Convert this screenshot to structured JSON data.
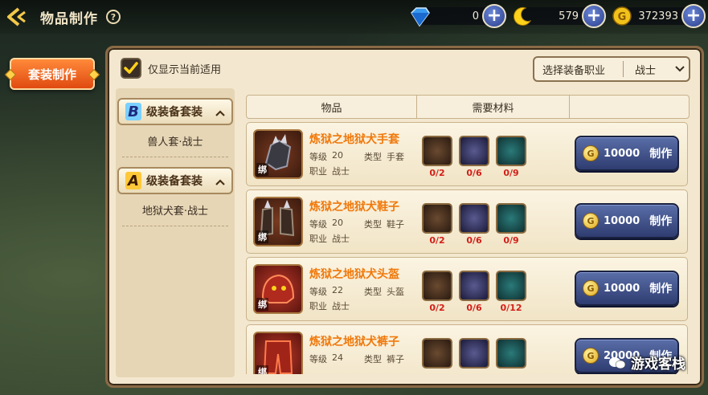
{
  "header": {
    "title": "物品制作",
    "help": "?"
  },
  "currencies": [
    {
      "name": "diamond",
      "icon": "diamond-icon",
      "value": "0"
    },
    {
      "name": "moon",
      "icon": "moon-icon",
      "value": "579"
    },
    {
      "name": "gold",
      "icon": "gold-coin-icon",
      "value": "372393"
    }
  ],
  "left_tab": {
    "label": "套装制作"
  },
  "filter": {
    "label": "仅显示当前适用",
    "checked": true
  },
  "job_select": {
    "label": "选择装备职业",
    "value": "战士"
  },
  "categories": [
    {
      "grade": "B",
      "title": "级装备套装",
      "items": [
        "兽人套·战士"
      ]
    },
    {
      "grade": "A",
      "title": "级装备套装",
      "items": [
        "地狱犬套·战士"
      ]
    }
  ],
  "table_headers": [
    "物品",
    "需要材料",
    ""
  ],
  "bind_label": "绑",
  "rows": [
    {
      "name": "炼狱之地狱犬手套",
      "level_label": "等级",
      "level": "20",
      "type_label": "类型",
      "type": "手套",
      "job_label": "职业",
      "job": "战士",
      "materials": [
        "0/2",
        "0/6",
        "0/9"
      ],
      "cost": "10000",
      "make_label": "制作"
    },
    {
      "name": "炼狱之地狱犬鞋子",
      "level_label": "等级",
      "level": "20",
      "type_label": "类型",
      "type": "鞋子",
      "job_label": "职业",
      "job": "战士",
      "materials": [
        "0/2",
        "0/6",
        "0/9"
      ],
      "cost": "10000",
      "make_label": "制作"
    },
    {
      "name": "炼狱之地狱犬头盔",
      "level_label": "等级",
      "level": "22",
      "type_label": "类型",
      "type": "头盔",
      "job_label": "职业",
      "job": "战士",
      "materials": [
        "0/2",
        "0/6",
        "0/12"
      ],
      "cost": "10000",
      "make_label": "制作"
    },
    {
      "name": "炼狱之地狱犬裤子",
      "level_label": "等级",
      "level": "24",
      "type_label": "类型",
      "type": "裤子",
      "job_label": "",
      "job": "",
      "materials": [
        "",
        "",
        ""
      ],
      "cost": "20000",
      "make_label": "制作"
    }
  ],
  "watermark": "游戏客栈"
}
